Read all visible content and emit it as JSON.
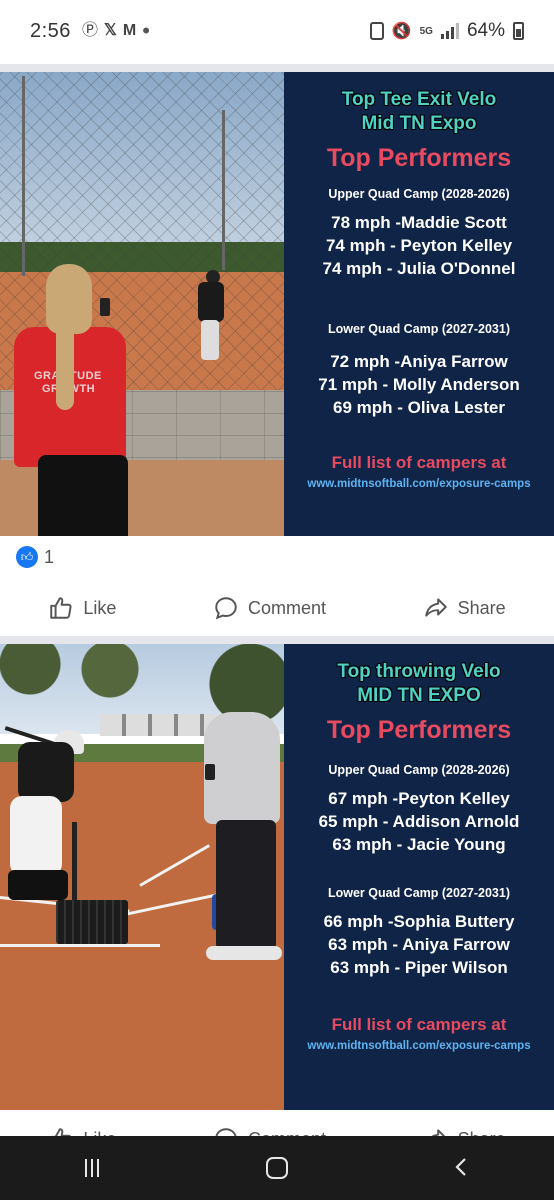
{
  "status_bar": {
    "time": "2:56",
    "battery_percent": "64%",
    "network_label": "5G"
  },
  "posts": [
    {
      "panel": {
        "title_line1": "Top Tee Exit Velo",
        "title_line2": "Mid TN Expo",
        "heading": "Top Performers",
        "upper_camp": "Upper Quad Camp (2028-2026)",
        "upper_rows": [
          "78 mph -Maddie Scott",
          "74 mph - Peyton Kelley",
          "74 mph  - Julia O'Donnel"
        ],
        "lower_camp": "Lower Quad Camp (2027-2031)",
        "lower_rows": [
          "72 mph -Aniya Farrow",
          "71 mph - Molly Anderson",
          "69 mph  - Oliva Lester"
        ],
        "cta": "Full list of campers at",
        "url": "www.midtnsoftball.com/exposure-camps"
      },
      "shirt_text_line1": "GRATITUDE",
      "shirt_text_line2": "GROWTH",
      "reaction_count": "1",
      "actions": {
        "like": "Like",
        "comment": "Comment",
        "share": "Share"
      }
    },
    {
      "panel": {
        "title_line1": "Top throwing Velo",
        "title_line2": "MID TN EXPO",
        "heading": "Top Performers",
        "upper_camp": "Upper Quad Camp (2028-2026)",
        "upper_rows": [
          "67 mph -Peyton Kelley",
          "65 mph - Addison Arnold",
          "63 mph  - Jacie Young"
        ],
        "lower_camp": "Lower Quad Camp (2027-2031)",
        "lower_rows": [
          "66 mph -Sophia Buttery",
          "63 mph - Aniya Farrow",
          "63 mph  - Piper Wilson"
        ],
        "cta": "Full list of campers at",
        "url": "www.midtnsoftball.com/exposure-camps"
      },
      "actions": {
        "like": "Like",
        "comment": "Comment",
        "share": "Share"
      }
    }
  ],
  "colors": {
    "panel_bg": "#0f2447",
    "title_teal": "#4fd1c5",
    "heading_red": "#e84a5f",
    "url_blue": "#5fb3f0",
    "facebook_blue": "#1877f2"
  }
}
